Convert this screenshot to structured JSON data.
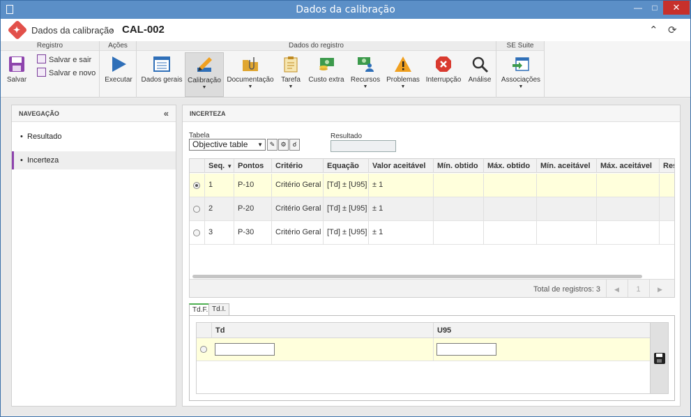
{
  "window": {
    "title": "Dados da calibração"
  },
  "header": {
    "breadcrumb": "Dados da calibração",
    "separator": "›",
    "record_id": "CAL-002"
  },
  "ribbon": {
    "groups": [
      {
        "title": "Registro"
      },
      {
        "title": "Ações"
      },
      {
        "title": "Dados do registro"
      },
      {
        "title": "SE Suite"
      }
    ],
    "save_label": "Salvar",
    "save_exit_label": "Salvar e sair",
    "save_new_label": "Salvar e novo",
    "execute_label": "Executar",
    "buttons": [
      {
        "label": "Dados gerais",
        "icon": "list-icon"
      },
      {
        "label": "Calibração",
        "icon": "pencil-ruler-icon"
      },
      {
        "label": "Documentação",
        "icon": "folder-clip-icon"
      },
      {
        "label": "Tarefa",
        "icon": "clipboard-icon"
      },
      {
        "label": "Custo extra",
        "icon": "money-icon"
      },
      {
        "label": "Recursos",
        "icon": "people-money-icon"
      },
      {
        "label": "Problemas",
        "icon": "warning-icon"
      },
      {
        "label": "Interrupção",
        "icon": "stop-icon"
      },
      {
        "label": "Análise",
        "icon": "magnifier-icon"
      }
    ],
    "associations_label": "Associações"
  },
  "navigation": {
    "title": "NAVEGAÇÃO",
    "items": [
      {
        "label": "Resultado"
      },
      {
        "label": "Incerteza"
      }
    ]
  },
  "main": {
    "title": "INCERTEZA",
    "table_label": "Tabela",
    "table_value": "Objective table",
    "result_label": "Resultado",
    "columns": [
      "Seq.",
      "Pontos",
      "Critério",
      "Equação",
      "Valor aceitável",
      "Mín. obtido",
      "Máx. obtido",
      "Mín. aceitável",
      "Máx. aceitável",
      "Res"
    ],
    "rows": [
      {
        "seq": "1",
        "pontos": "P-10",
        "criterio": "Critério Geral",
        "equacao": "[Td] ± [U95]",
        "valor": "± 1"
      },
      {
        "seq": "2",
        "pontos": "P-20",
        "criterio": "Critério Geral",
        "equacao": "[Td] ± [U95]",
        "valor": "± 1"
      },
      {
        "seq": "3",
        "pontos": "P-30",
        "criterio": "Critério Geral",
        "equacao": "[Td] ± [U95]",
        "valor": "± 1"
      }
    ],
    "total_label": "Total de registros: 3",
    "page": "1",
    "tabs": [
      {
        "label": "Td.F."
      },
      {
        "label": "Td.I."
      }
    ],
    "sub_columns": [
      "Td",
      "U95"
    ],
    "sub_values": {
      "td": "",
      "u95": ""
    }
  }
}
